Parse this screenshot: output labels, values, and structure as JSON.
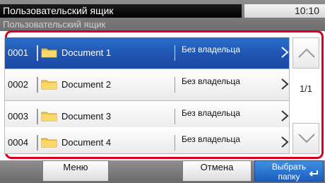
{
  "header": {
    "title": "Пользовательский ящик",
    "subtitle": "Пользовательский ящик",
    "time": "10:10"
  },
  "list": {
    "rows": [
      {
        "number": "0001",
        "name": "Document 1",
        "owner": "Без владельца",
        "selected": true
      },
      {
        "number": "0002",
        "name": "Document 2",
        "owner": "Без владельца",
        "selected": false
      },
      {
        "number": "0003",
        "name": "Document 3",
        "owner": "Без владельца",
        "selected": false
      },
      {
        "number": "0004",
        "name": "Document 4",
        "owner": "Без владельца",
        "selected": false
      }
    ],
    "page_indicator": "1/1"
  },
  "footer": {
    "menu_label": "Меню",
    "cancel_label": "Отмена",
    "select_folder_label": "Выбрать папку"
  },
  "icons": {
    "folder": "folder-icon",
    "chevron": "chevron-right-icon",
    "up": "arrow-up-icon",
    "down": "arrow-down-icon",
    "enter": "enter-icon"
  },
  "colors": {
    "accent": "#d8001f",
    "selected": "#1f52b0",
    "primary_button": "#2a76d2"
  }
}
